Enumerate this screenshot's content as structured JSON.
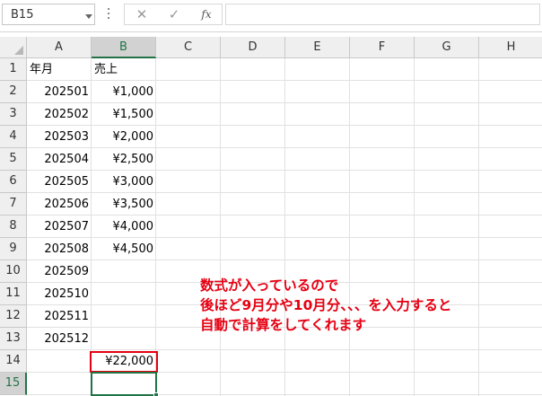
{
  "formula_bar": {
    "name_box": "B15",
    "cancel_icon": "✕",
    "enter_icon": "✓",
    "fx_label": "fx",
    "formula": ""
  },
  "columns": [
    "A",
    "B",
    "C",
    "D",
    "E",
    "F",
    "G",
    "H"
  ],
  "rows": [
    "1",
    "2",
    "3",
    "4",
    "5",
    "6",
    "7",
    "8",
    "9",
    "10",
    "11",
    "12",
    "13",
    "14",
    "15"
  ],
  "cells": {
    "A": [
      "年月",
      "202501",
      "202502",
      "202503",
      "202504",
      "202505",
      "202506",
      "202507",
      "202508",
      "202509",
      "202510",
      "202511",
      "202512",
      "",
      ""
    ],
    "B": [
      "売上",
      "¥1,000",
      "¥1,500",
      "¥2,000",
      "¥2,500",
      "¥3,000",
      "¥3,500",
      "¥4,000",
      "¥4,500",
      "",
      "",
      "",
      "",
      "¥22,000",
      ""
    ]
  },
  "selected_cell": {
    "column": "B",
    "row": "15"
  },
  "highlighted_cell": {
    "column": "B",
    "row": "14"
  },
  "annotation": {
    "lines": [
      "数式が入っているので",
      "後ほど9月分や10月分、、、を入力すると",
      "自動で計算をしてくれます"
    ],
    "color": "#e60012"
  },
  "colors": {
    "selection": "#217346",
    "highlight_border": "#e60012",
    "header_bg": "#efefef"
  }
}
